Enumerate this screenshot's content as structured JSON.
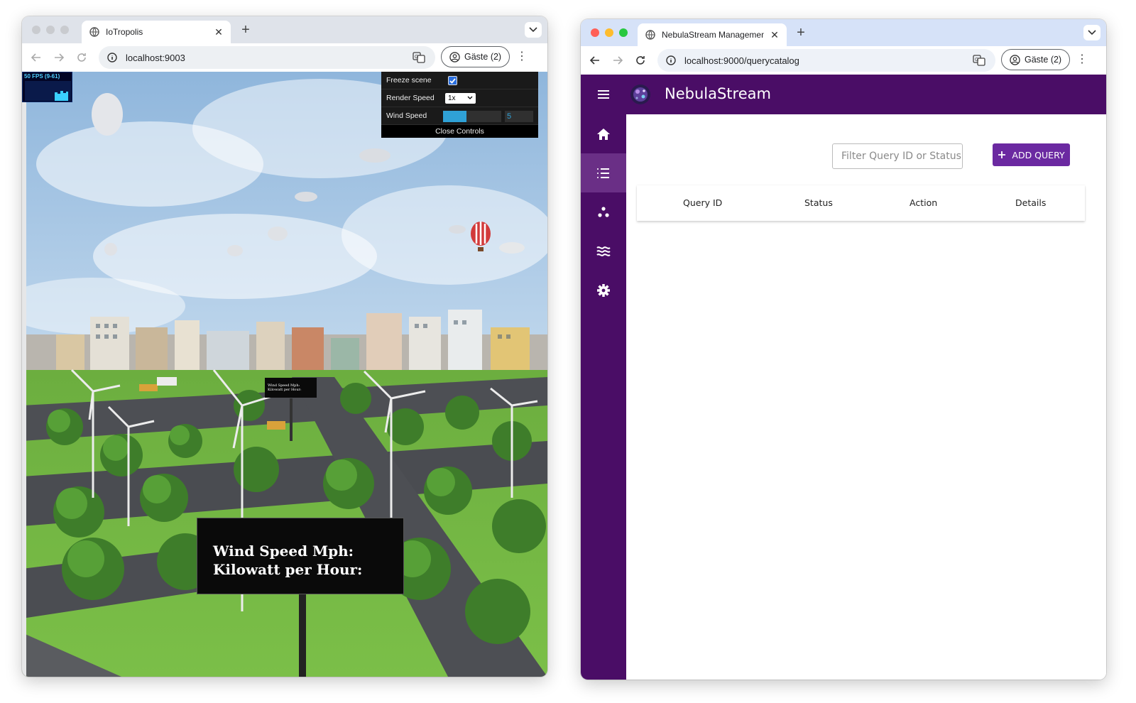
{
  "left_window": {
    "tab_title": "IoTropolis",
    "url": "localhost:9003",
    "profile_label": "Gäste (2)",
    "fps": {
      "label": "50 FPS (9-61)"
    },
    "controls": {
      "freeze_label": "Freeze scene",
      "freeze_checked": true,
      "render_speed_label": "Render Speed",
      "render_speed_value": "1x",
      "wind_speed_label": "Wind Speed",
      "wind_speed_value": "5",
      "wind_speed_fraction": 0.4,
      "close_label": "Close Controls"
    },
    "sign": {
      "line1": "Wind Speed Mph:",
      "line2": "Kilowatt per Hour:"
    },
    "mini_sign": {
      "line1": "Wind Speed Mph:",
      "line2": "Kilowatt per Hour:"
    }
  },
  "right_window": {
    "tab_title": "NebulaStream Management U",
    "url": "localhost:9000/querycatalog",
    "profile_label": "Gäste (2)",
    "app_title": "NebulaStream",
    "accent_color": "#4a0d66",
    "button_color": "#6b29a1",
    "sidebar": [
      "home-icon",
      "list-icon",
      "topology-icon",
      "stream-icon",
      "settings-icon"
    ],
    "filter_placeholder": "Filter Query ID or Status",
    "add_button_label": "ADD QUERY",
    "table_columns": [
      "Query ID",
      "Status",
      "Action",
      "Details"
    ]
  }
}
